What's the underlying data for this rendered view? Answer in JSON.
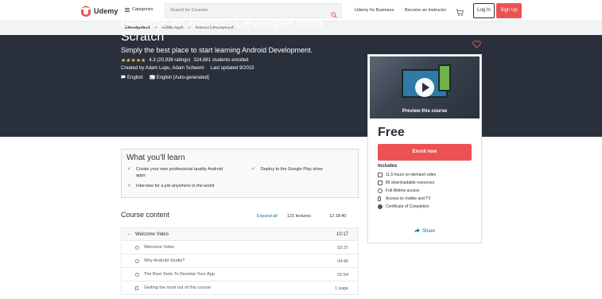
{
  "header": {
    "logo_text": "Udemy",
    "categories_label": "Categories",
    "search_placeholder": "Search for Courses",
    "udemy_for_business": "Udemy for Business",
    "become_instructor": "Become an Instructor",
    "login_label": "Log In",
    "signup_label": "Sign Up",
    "accent_color": "#ec5252"
  },
  "breadcrumb": {
    "items": [
      "Development",
      "Mobile Apps",
      "Android Development"
    ],
    "separator": ">"
  },
  "hero": {
    "title": "Become an Android Developer from Scratch",
    "subtitle": "Simply the best place to start learning Android Development.",
    "rating": "4.3 (20,938 ratings)",
    "stars_filled": 4.3,
    "students": "324,681 students enrolled",
    "created_by": "Created by Adam Lupu, Adam Schwem",
    "last_updated": "Last updated 9/2015",
    "language": "English",
    "captions": "English [Auto-generated]"
  },
  "card": {
    "preview_label": "Preview this course",
    "price": "Free",
    "enroll_label": "Enroll now",
    "includes_title": "Includes",
    "includes": [
      {
        "icon": "video-icon",
        "text": "11.5 hours on-demand video"
      },
      {
        "icon": "file-icon",
        "text": "85 downloadable resources"
      },
      {
        "icon": "infinity-icon",
        "text": "Full lifetime access"
      },
      {
        "icon": "mobile-icon",
        "text": "Access on mobile and TV"
      },
      {
        "icon": "certificate-icon",
        "text": "Certificate of Completion"
      }
    ],
    "share_label": "Share"
  },
  "learn": {
    "title": "What you'll learn",
    "items": [
      "Create your own professional quality Android apps",
      "Deploy to the Google Play store",
      "Interview for a job anywhere in the world"
    ]
  },
  "content": {
    "title": "Course content",
    "expand_all": "Expand all",
    "lectures_count": "121 lectures",
    "total_duration": "12:18:40",
    "section": {
      "label": "Welcome Video",
      "duration": "10:17"
    },
    "lectures": [
      {
        "label": "Welcome Video",
        "duration": "02:37",
        "type": "video"
      },
      {
        "label": "Why Android Studio?",
        "duration": "04:46",
        "type": "video"
      },
      {
        "label": "The Best Tools To Develop Your App",
        "duration": "02:54",
        "type": "video"
      },
      {
        "label": "Getting the most out of this course",
        "duration": "1 page",
        "type": "article"
      }
    ]
  }
}
